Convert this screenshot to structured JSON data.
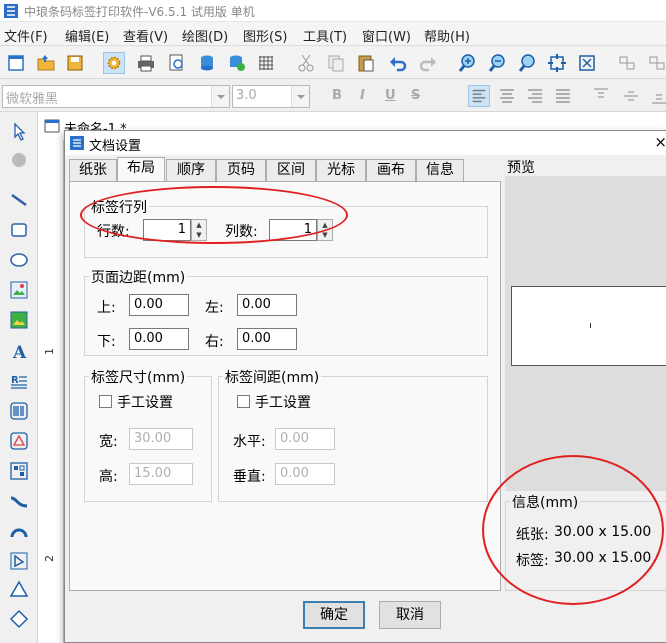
{
  "app": {
    "title": "中琅条码标签打印软件-V6.5.1 试用版 单机"
  },
  "menu": [
    "文件(F)",
    "编辑(E)",
    "查看(V)",
    "绘图(D)",
    "图形(S)",
    "工具(T)",
    "窗口(W)",
    "帮助(H)"
  ],
  "format_bar": {
    "font_name": "微软雅黑",
    "font_size": "3.0",
    "bold": "B",
    "italic": "I",
    "underline": "U",
    "strike": "S"
  },
  "document": {
    "tab_label": "未命名-1 *",
    "ruler_marks": [
      "1",
      "2"
    ]
  },
  "dialog": {
    "title": "文档设置",
    "close": "×",
    "tabs": [
      "纸张",
      "布局",
      "顺序",
      "页码",
      "区间",
      "光标",
      "画布",
      "信息"
    ],
    "active_tab": "布局",
    "label_rows_cols": {
      "title": "标签行列",
      "rows_label": "行数:",
      "rows_value": "1",
      "cols_label": "列数:",
      "cols_value": "1"
    },
    "page_margin": {
      "title": "页面边距(mm)",
      "top_label": "上:",
      "top_value": "0.00",
      "left_label": "左:",
      "left_value": "0.00",
      "bottom_label": "下:",
      "bottom_value": "0.00",
      "right_label": "右:",
      "right_value": "0.00"
    },
    "label_size": {
      "title": "标签尺寸(mm)",
      "manual": "手工设置",
      "width_label": "宽:",
      "width_value": "30.00",
      "height_label": "高:",
      "height_value": "15.00"
    },
    "label_spacing": {
      "title": "标签间距(mm)",
      "manual": "手工设置",
      "horizontal_label": "水平:",
      "horizontal_value": "0.00",
      "vertical_label": "垂直:",
      "vertical_value": "0.00"
    },
    "preview": {
      "label": "预览"
    },
    "info": {
      "title": "信息(mm)",
      "paper_label": "纸张:",
      "paper_value": "30.00 x 15.00",
      "label_label": "标签:",
      "label_value": "30.00 x 15.00"
    },
    "buttons": {
      "ok": "确定",
      "cancel": "取消"
    }
  },
  "colors": {
    "annotation_red": "#e02020",
    "toolbar_selected": "#cde3f7"
  }
}
